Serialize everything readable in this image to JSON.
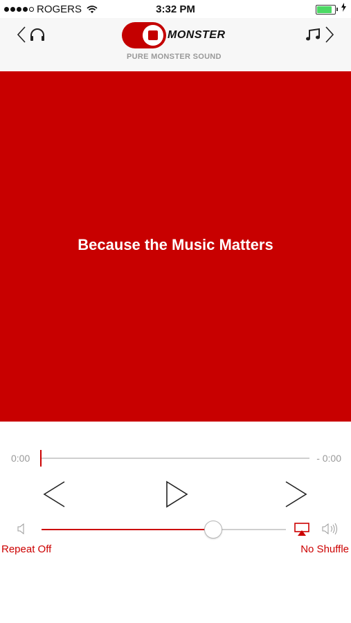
{
  "status_bar": {
    "signal_bars": 4,
    "carrier": "ROGERS",
    "time": "3:32 PM",
    "battery_percent": 0.85
  },
  "header": {
    "brand": "MONSTER",
    "tagline": "PURE MONSTER SOUND",
    "left_icon": "headphones-icon",
    "right_icon": "music-note-icon"
  },
  "banner": {
    "text": "Because the Music Matters",
    "color": "#c80000"
  },
  "player": {
    "elapsed": "0:00",
    "remaining": "- 0:00",
    "progress": 0,
    "volume": 0.7,
    "repeat_label": "Repeat Off",
    "shuffle_label": "No Shuffle",
    "accent_color": "#c00000"
  }
}
